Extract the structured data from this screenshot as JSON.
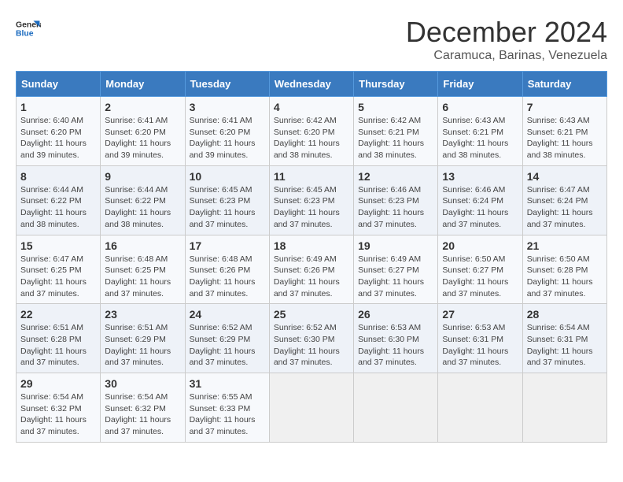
{
  "logo": {
    "general": "General",
    "blue": "Blue"
  },
  "header": {
    "month": "December 2024",
    "location": "Caramuca, Barinas, Venezuela"
  },
  "weekdays": [
    "Sunday",
    "Monday",
    "Tuesday",
    "Wednesday",
    "Thursday",
    "Friday",
    "Saturday"
  ],
  "weeks": [
    [
      {
        "day": "1",
        "sunrise": "6:40 AM",
        "sunset": "6:20 PM",
        "daylight": "11 hours and 39 minutes."
      },
      {
        "day": "2",
        "sunrise": "6:41 AM",
        "sunset": "6:20 PM",
        "daylight": "11 hours and 39 minutes."
      },
      {
        "day": "3",
        "sunrise": "6:41 AM",
        "sunset": "6:20 PM",
        "daylight": "11 hours and 39 minutes."
      },
      {
        "day": "4",
        "sunrise": "6:42 AM",
        "sunset": "6:20 PM",
        "daylight": "11 hours and 38 minutes."
      },
      {
        "day": "5",
        "sunrise": "6:42 AM",
        "sunset": "6:21 PM",
        "daylight": "11 hours and 38 minutes."
      },
      {
        "day": "6",
        "sunrise": "6:43 AM",
        "sunset": "6:21 PM",
        "daylight": "11 hours and 38 minutes."
      },
      {
        "day": "7",
        "sunrise": "6:43 AM",
        "sunset": "6:21 PM",
        "daylight": "11 hours and 38 minutes."
      }
    ],
    [
      {
        "day": "8",
        "sunrise": "6:44 AM",
        "sunset": "6:22 PM",
        "daylight": "11 hours and 38 minutes."
      },
      {
        "day": "9",
        "sunrise": "6:44 AM",
        "sunset": "6:22 PM",
        "daylight": "11 hours and 38 minutes."
      },
      {
        "day": "10",
        "sunrise": "6:45 AM",
        "sunset": "6:23 PM",
        "daylight": "11 hours and 37 minutes."
      },
      {
        "day": "11",
        "sunrise": "6:45 AM",
        "sunset": "6:23 PM",
        "daylight": "11 hours and 37 minutes."
      },
      {
        "day": "12",
        "sunrise": "6:46 AM",
        "sunset": "6:23 PM",
        "daylight": "11 hours and 37 minutes."
      },
      {
        "day": "13",
        "sunrise": "6:46 AM",
        "sunset": "6:24 PM",
        "daylight": "11 hours and 37 minutes."
      },
      {
        "day": "14",
        "sunrise": "6:47 AM",
        "sunset": "6:24 PM",
        "daylight": "11 hours and 37 minutes."
      }
    ],
    [
      {
        "day": "15",
        "sunrise": "6:47 AM",
        "sunset": "6:25 PM",
        "daylight": "11 hours and 37 minutes."
      },
      {
        "day": "16",
        "sunrise": "6:48 AM",
        "sunset": "6:25 PM",
        "daylight": "11 hours and 37 minutes."
      },
      {
        "day": "17",
        "sunrise": "6:48 AM",
        "sunset": "6:26 PM",
        "daylight": "11 hours and 37 minutes."
      },
      {
        "day": "18",
        "sunrise": "6:49 AM",
        "sunset": "6:26 PM",
        "daylight": "11 hours and 37 minutes."
      },
      {
        "day": "19",
        "sunrise": "6:49 AM",
        "sunset": "6:27 PM",
        "daylight": "11 hours and 37 minutes."
      },
      {
        "day": "20",
        "sunrise": "6:50 AM",
        "sunset": "6:27 PM",
        "daylight": "11 hours and 37 minutes."
      },
      {
        "day": "21",
        "sunrise": "6:50 AM",
        "sunset": "6:28 PM",
        "daylight": "11 hours and 37 minutes."
      }
    ],
    [
      {
        "day": "22",
        "sunrise": "6:51 AM",
        "sunset": "6:28 PM",
        "daylight": "11 hours and 37 minutes."
      },
      {
        "day": "23",
        "sunrise": "6:51 AM",
        "sunset": "6:29 PM",
        "daylight": "11 hours and 37 minutes."
      },
      {
        "day": "24",
        "sunrise": "6:52 AM",
        "sunset": "6:29 PM",
        "daylight": "11 hours and 37 minutes."
      },
      {
        "day": "25",
        "sunrise": "6:52 AM",
        "sunset": "6:30 PM",
        "daylight": "11 hours and 37 minutes."
      },
      {
        "day": "26",
        "sunrise": "6:53 AM",
        "sunset": "6:30 PM",
        "daylight": "11 hours and 37 minutes."
      },
      {
        "day": "27",
        "sunrise": "6:53 AM",
        "sunset": "6:31 PM",
        "daylight": "11 hours and 37 minutes."
      },
      {
        "day": "28",
        "sunrise": "6:54 AM",
        "sunset": "6:31 PM",
        "daylight": "11 hours and 37 minutes."
      }
    ],
    [
      {
        "day": "29",
        "sunrise": "6:54 AM",
        "sunset": "6:32 PM",
        "daylight": "11 hours and 37 minutes."
      },
      {
        "day": "30",
        "sunrise": "6:54 AM",
        "sunset": "6:32 PM",
        "daylight": "11 hours and 37 minutes."
      },
      {
        "day": "31",
        "sunrise": "6:55 AM",
        "sunset": "6:33 PM",
        "daylight": "11 hours and 37 minutes."
      },
      null,
      null,
      null,
      null
    ]
  ],
  "labels": {
    "sunrise": "Sunrise:",
    "sunset": "Sunset:",
    "daylight": "Daylight:"
  }
}
